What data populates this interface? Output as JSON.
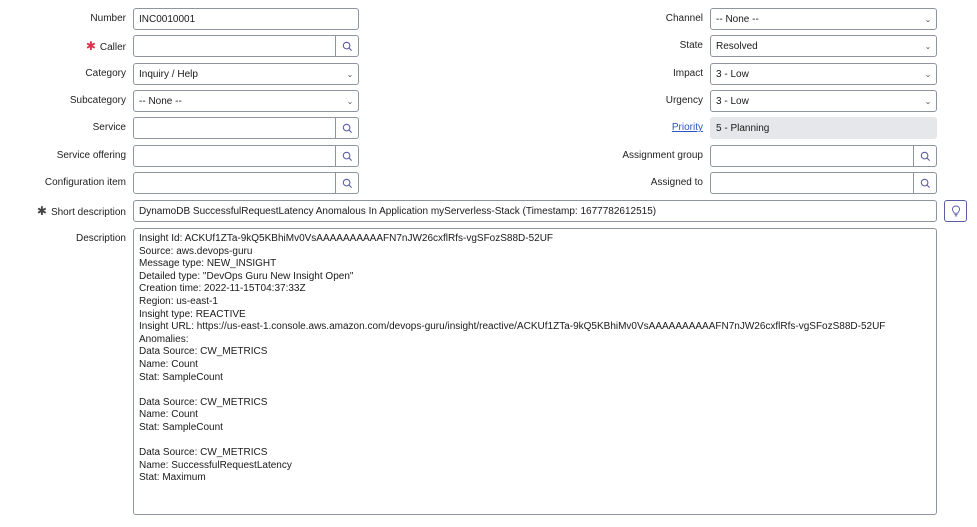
{
  "left_fields": {
    "number": {
      "label": "Number",
      "value": "INC0010001"
    },
    "caller": {
      "label": "Caller",
      "value": "",
      "required": true
    },
    "category": {
      "label": "Category",
      "value": "Inquiry / Help"
    },
    "subcategory": {
      "label": "Subcategory",
      "value": "-- None --"
    },
    "service": {
      "label": "Service",
      "value": ""
    },
    "service_offering": {
      "label": "Service offering",
      "value": ""
    },
    "configuration_item": {
      "label": "Configuration item",
      "value": ""
    }
  },
  "right_fields": {
    "channel": {
      "label": "Channel",
      "value": "-- None --"
    },
    "state": {
      "label": "State",
      "value": "Resolved"
    },
    "impact": {
      "label": "Impact",
      "value": "3 - Low"
    },
    "urgency": {
      "label": "Urgency",
      "value": "3 - Low"
    },
    "priority": {
      "label": "Priority",
      "value": "5 - Planning"
    },
    "assignment_group": {
      "label": "Assignment group",
      "value": ""
    },
    "assigned_to": {
      "label": "Assigned to",
      "value": ""
    }
  },
  "short_description": {
    "label": "Short description",
    "value": "DynamoDB SuccessfulRequestLatency Anomalous In Application myServerless-Stack (Timestamp: 1677782612515)"
  },
  "description": {
    "label": "Description",
    "value": "Insight Id: ACKUf1ZTa-9kQ5KBhiMv0VsAAAAAAAAAAFN7nJW26cxflRfs-vgSFozS88D-52UF\nSource: aws.devops-guru\nMessage type: NEW_INSIGHT\nDetailed type: \"DevOps Guru New Insight Open\"\nCreation time: 2022-11-15T04:37:33Z\nRegion: us-east-1\nInsight type: REACTIVE\nInsight URL: https://us-east-1.console.aws.amazon.com/devops-guru/insight/reactive/ACKUf1ZTa-9kQ5KBhiMv0VsAAAAAAAAAAFN7nJW26cxflRfs-vgSFozS88D-52UF\nAnomalies:\nData Source: CW_METRICS\nName: Count\nStat: SampleCount\n\nData Source: CW_METRICS\nName: Count\nStat: SampleCount\n\nData Source: CW_METRICS\nName: SuccessfulRequestLatency\nStat: Maximum"
  },
  "icons": {
    "lookup": "search-icon",
    "select": "chevron-down-icon",
    "suggest": "lightbulb-icon",
    "required": "asterisk-icon"
  },
  "colors": {
    "required": "#d8344a",
    "link": "#2a55c4",
    "icon": "#5b5ea6",
    "readonly_bg": "#e6e7ea"
  }
}
